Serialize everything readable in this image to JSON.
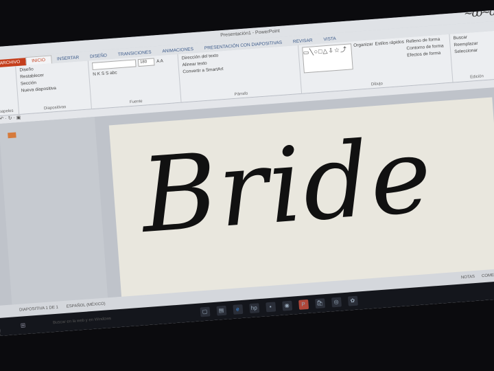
{
  "window": {
    "title": "Presentación1 - PowerPoint"
  },
  "tabs": [
    "ARCHIVO",
    "INICIO",
    "INSERTAR",
    "DISEÑO",
    "TRANSICIONES",
    "ANIMACIONES",
    "PRESENTACIÓN CON DIAPOSITIVAS",
    "REVISAR",
    "VISTA"
  ],
  "ribbon": {
    "clipboard": {
      "label": "Portapapeles"
    },
    "slides": {
      "new_slide": "Nueva diapositiva",
      "layout": "Diseño",
      "reset": "Restablecer",
      "section": "Sección",
      "label": "Diapositivas"
    },
    "font": {
      "size": "180",
      "format": "N K S S abc",
      "label": "Fuente"
    },
    "paragraph": {
      "text_direction": "Dirección del texto",
      "align_text": "Alinear texto",
      "smartart": "Convertir a SmartArt",
      "label": "Párrafo"
    },
    "drawing": {
      "arrange": "Organizar",
      "quick_styles": "Estilos rápidos",
      "fill": "Relleno de forma",
      "outline": "Contorno de forma",
      "effects": "Efectos de forma",
      "label": "Dibujo"
    },
    "editing": {
      "find": "Buscar",
      "replace": "Reemplazar",
      "select": "Seleccionar",
      "label": "Edición"
    }
  },
  "slide": {
    "text": "Bride"
  },
  "status": {
    "slide": "DIAPOSITIVA 1 DE 1",
    "language": "ESPAÑOL (MÉXICO)",
    "notes": "NOTAS",
    "comments": "COMENTARIOS"
  },
  "taskbar": {
    "search": "Buscar en la web y en Windows"
  }
}
